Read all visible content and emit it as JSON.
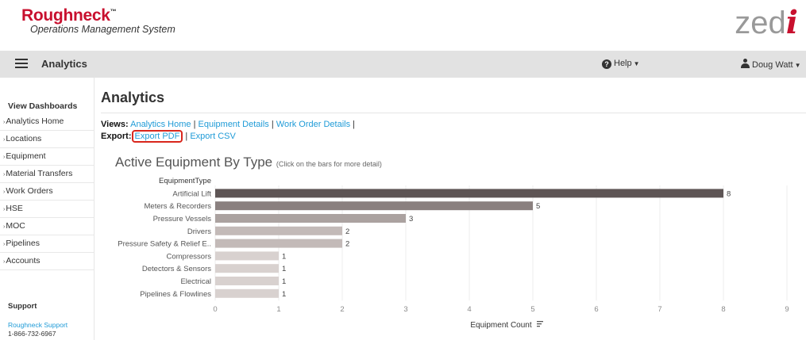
{
  "brand": {
    "name": "Roughneck",
    "tm": "™",
    "subtitle": "Operations Management System",
    "logo_main": "zed",
    "logo_accent": "i"
  },
  "navbar": {
    "title": "Analytics",
    "help": "Help",
    "user": "Doug Watt"
  },
  "sidebar": {
    "heading": "View Dashboards",
    "items": [
      {
        "label": "Analytics Home"
      },
      {
        "label": "Locations"
      },
      {
        "label": "Equipment"
      },
      {
        "label": "Material Transfers"
      },
      {
        "label": "Work Orders"
      },
      {
        "label": "HSE"
      },
      {
        "label": "MOC"
      },
      {
        "label": "Pipelines"
      },
      {
        "label": "Accounts"
      }
    ],
    "support_heading": "Support",
    "support_link": "Roughneck Support",
    "support_phone": "1-866-732-6967"
  },
  "main": {
    "title": "Analytics",
    "views_label": "Views:",
    "views": [
      "Analytics Home",
      "Equipment Details",
      "Work Order Details"
    ],
    "export_label": "Export:",
    "exports": [
      "Export PDF",
      "Export CSV"
    ]
  },
  "colors": {
    "brand_red": "#c8102e",
    "link_blue": "#1f9bd7",
    "highlight_red": "#d9261c"
  },
  "chart_data": {
    "type": "bar",
    "orientation": "horizontal",
    "title": "Active Equipment By Type",
    "subtitle": "(Click on the bars for more detail)",
    "category_header": "EquipmentType",
    "xlabel": "Equipment Count",
    "xlim": [
      0,
      9
    ],
    "xticks": [
      0,
      1,
      2,
      3,
      4,
      5,
      6,
      7,
      8,
      9
    ],
    "grid": true,
    "categories": [
      "Artificial Lift",
      "Meters & Recorders",
      "Pressure Vessels",
      "Drivers",
      "Pressure Safety & Relief E..",
      "Compressors",
      "Detectors & Sensors",
      "Electrical",
      "Pipelines & Flowlines"
    ],
    "values": [
      8,
      5,
      3,
      2,
      2,
      1,
      1,
      1,
      1
    ],
    "bar_colors": [
      "#5e5555",
      "#8a807f",
      "#aba2a0",
      "#c3bab8",
      "#c3bab8",
      "#d8d1cf",
      "#d8d1cf",
      "#d8d1cf",
      "#d8d1cf"
    ]
  }
}
